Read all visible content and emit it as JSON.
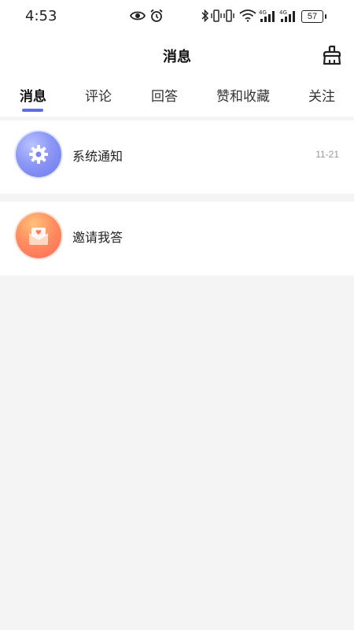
{
  "status_bar": {
    "time": "4:53",
    "battery": "57",
    "icons": [
      "eye-icon",
      "alarm-icon",
      "bluetooth-icon",
      "vibrate-icon",
      "wifi-icon",
      "signal-4g-icon",
      "signal-4g-icon"
    ]
  },
  "header": {
    "title": "消息",
    "action_icon": "broom-clean-icon"
  },
  "tabs": [
    {
      "label": "消息",
      "active": true
    },
    {
      "label": "评论",
      "active": false
    },
    {
      "label": "回答",
      "active": false
    },
    {
      "label": "赞和收藏",
      "active": false
    },
    {
      "label": "关注",
      "active": false
    }
  ],
  "accent_color": "#5b6ee6",
  "messages": [
    {
      "label": "系统通知",
      "date": "11-21",
      "icon": "gear-icon",
      "color": "#8c97f6"
    },
    {
      "label": "邀请我答",
      "date": "",
      "icon": "envelope-heart-icon",
      "color": "#ff7a5c"
    }
  ]
}
